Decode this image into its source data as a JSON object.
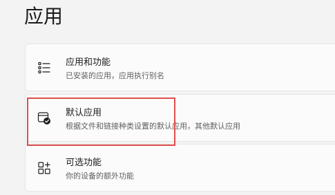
{
  "page": {
    "title": "应用"
  },
  "settings": [
    {
      "title": "应用和功能",
      "description": "已安装的应用，应用执行别名",
      "icon": "apps-list-icon"
    },
    {
      "title": "默认应用",
      "description": "根据文件和链接种类设置的默认应用，其他默认应用",
      "icon": "default-apps-icon"
    },
    {
      "title": "可选功能",
      "description": "你的设备的额外功能",
      "icon": "optional-features-icon"
    }
  ],
  "colors": {
    "background": "#f3f3f3",
    "card": "#fbfbfb",
    "highlight": "#e04d4d"
  }
}
